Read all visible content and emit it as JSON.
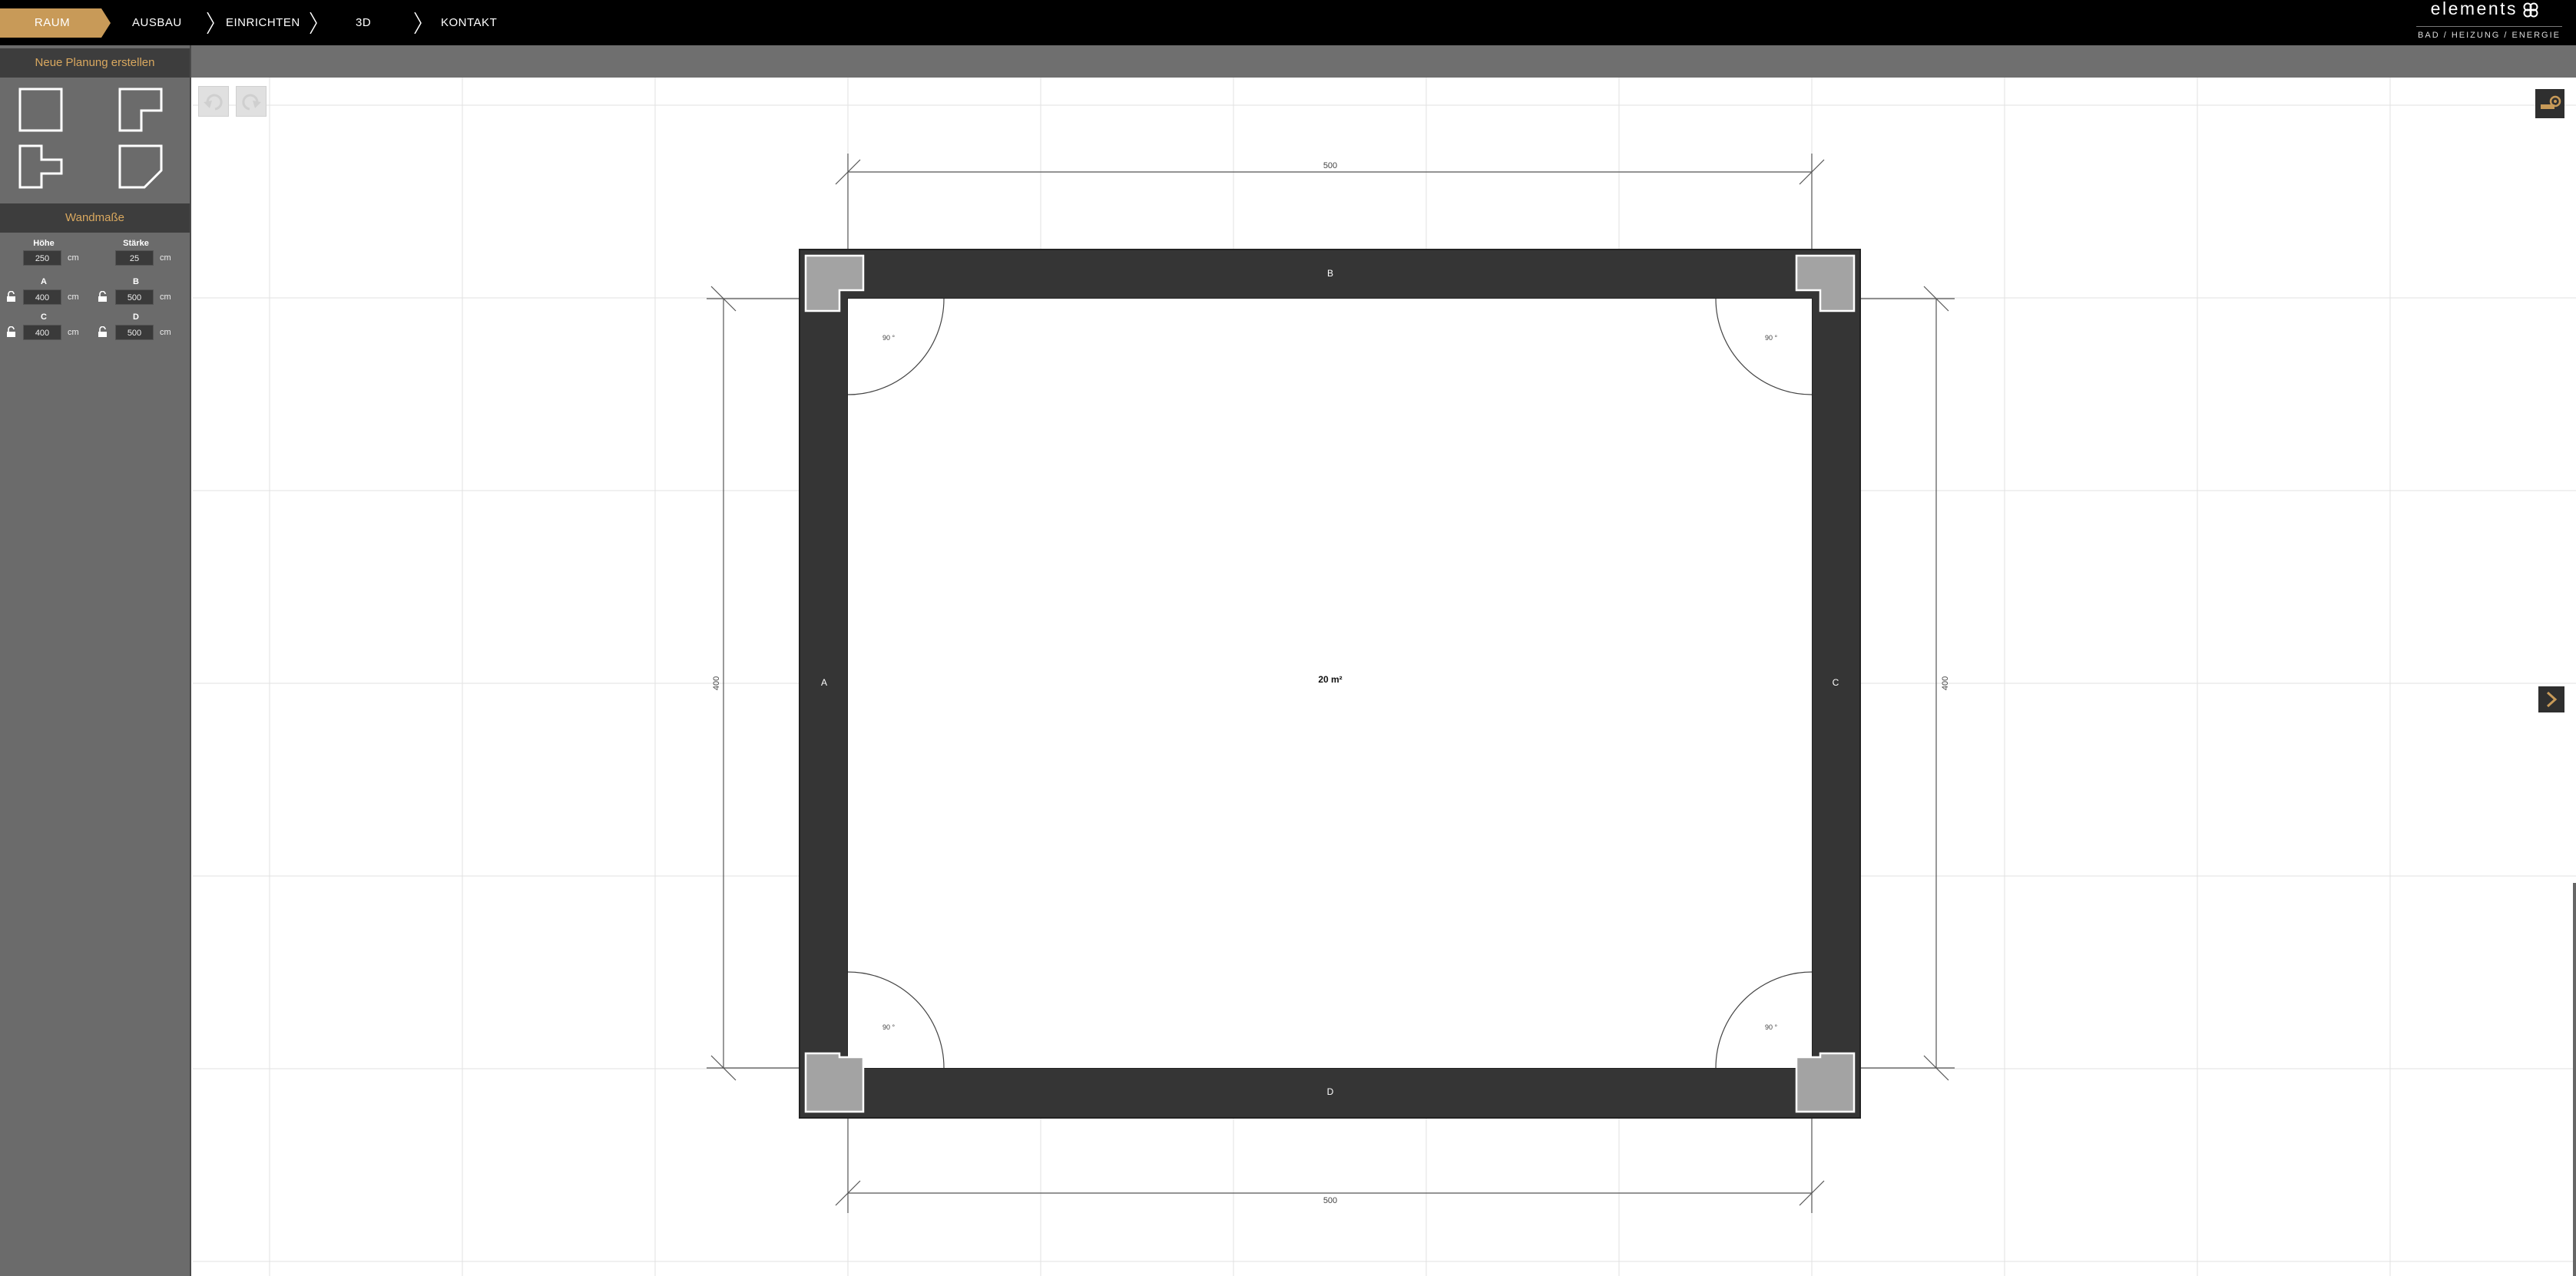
{
  "nav": {
    "steps": [
      {
        "label": "RAUM",
        "active": true
      },
      {
        "label": "AUSBAU"
      },
      {
        "label": "EINRICHTEN"
      },
      {
        "label": "3D"
      },
      {
        "label": "KONTAKT"
      }
    ]
  },
  "logo": {
    "name": "elements",
    "tagline": "BAD / HEIZUNG / ENERGIE"
  },
  "sidebar": {
    "new_plan_title": "Neue Planung erstellen",
    "wall_title": "Wandmaße",
    "hoehe_label": "Höhe",
    "hoehe_value": "250",
    "staerke_label": "Stärke",
    "staerke_value": "25",
    "unit": "cm",
    "walls": [
      {
        "label": "A",
        "value": "400"
      },
      {
        "label": "B",
        "value": "500"
      },
      {
        "label": "C",
        "value": "400"
      },
      {
        "label": "D",
        "value": "500"
      }
    ]
  },
  "plan": {
    "dim_top": "500",
    "dim_bottom": "500",
    "dim_left": "400",
    "dim_right": "400",
    "wall_a": "A",
    "wall_b": "B",
    "wall_c": "C",
    "wall_d": "D",
    "area": "20 m²",
    "angle_tl": "90 °",
    "angle_tr": "90 °",
    "angle_bl": "90 °",
    "angle_br": "90 °"
  },
  "colors": {
    "accent": "#c89a58",
    "accent_text": "#d9a85f",
    "wall": "#353535",
    "corner": "#a3a3a3",
    "topbar": "#000000",
    "sidebar": "#6b6b6b"
  },
  "icons": [
    "undo-icon",
    "redo-icon",
    "measure-tool-icon",
    "chevron-right-icon",
    "lock-icon",
    "logo-icon"
  ]
}
